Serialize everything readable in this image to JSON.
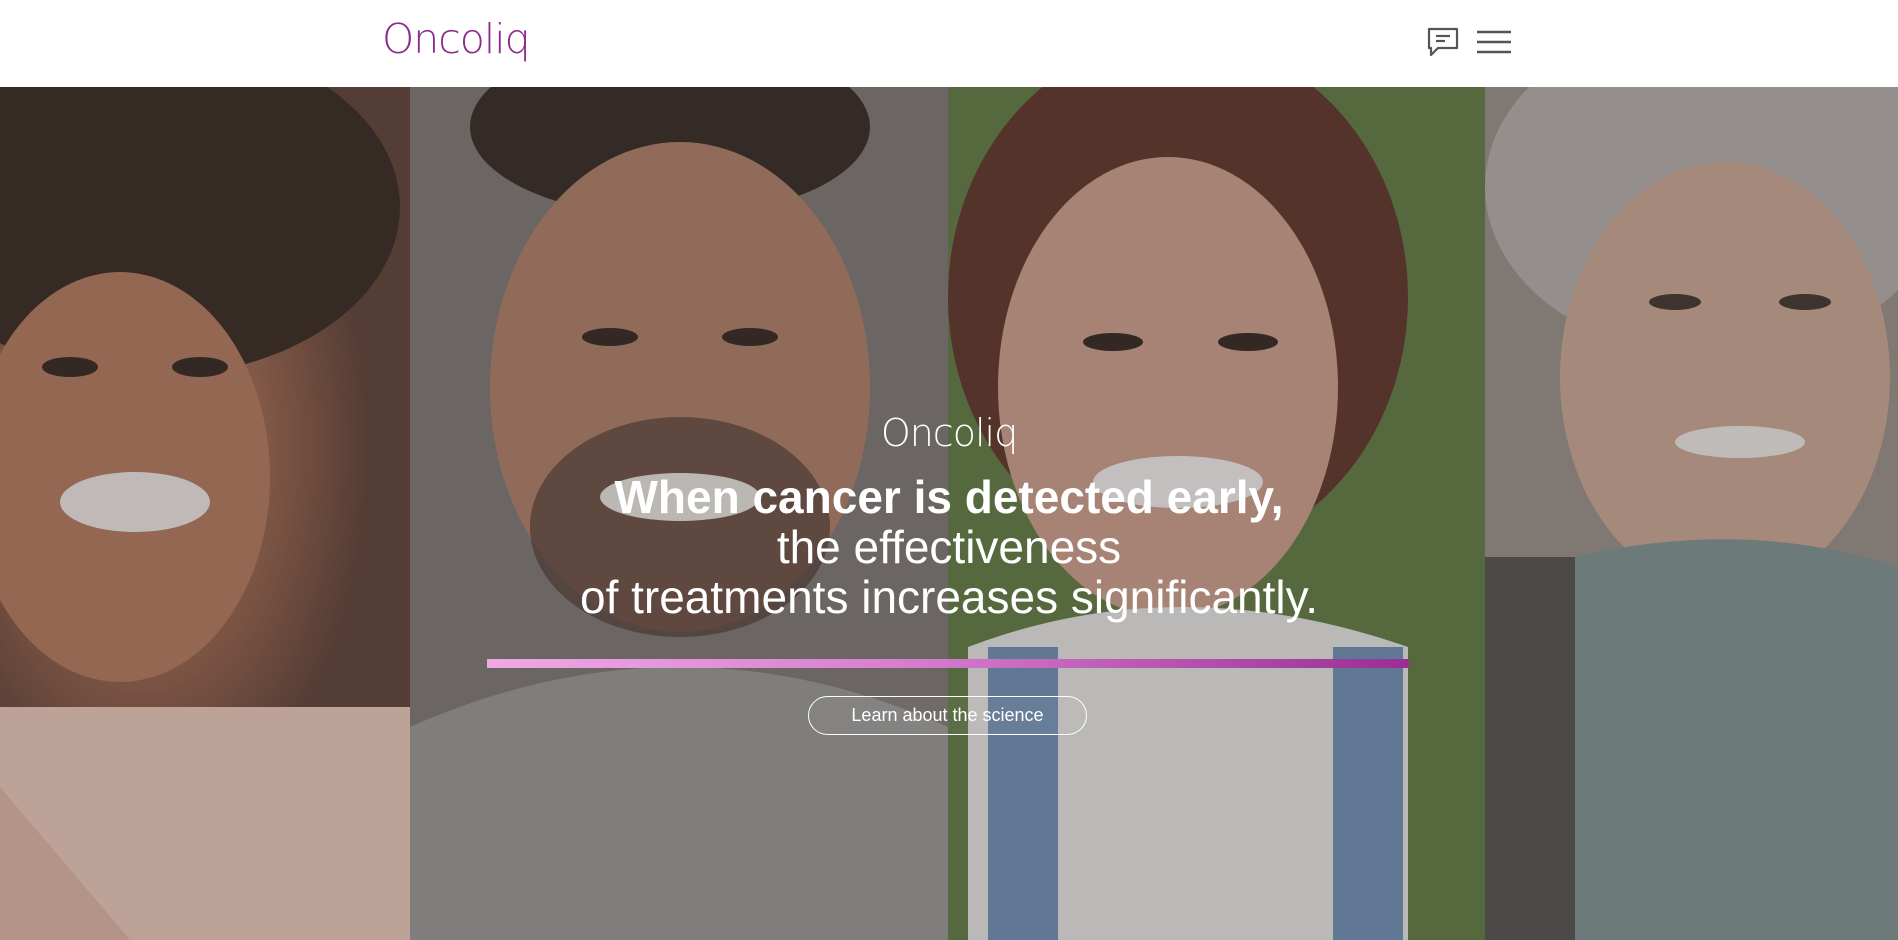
{
  "header": {
    "logo_text": "Oncoliq",
    "chat_icon": "chat-icon",
    "menu_icon": "hamburger-menu-icon"
  },
  "hero": {
    "logo_text": "Oncoliq",
    "headline": "When cancer is detected early,",
    "subline_1": "the effectiveness",
    "subline_2": "of treatments increases significantly.",
    "cta_label": "Learn about the science",
    "photos": [
      "smiling-woman-photo",
      "smiling-man-photo",
      "smiling-young-woman-photo",
      "smiling-older-woman-photo"
    ]
  },
  "colors": {
    "brand": "#8c2a8e",
    "accent_start": "#f0a8e4",
    "accent_end": "#9a2e94",
    "header_bg": "#ffffff",
    "icon_gray": "#555555"
  }
}
